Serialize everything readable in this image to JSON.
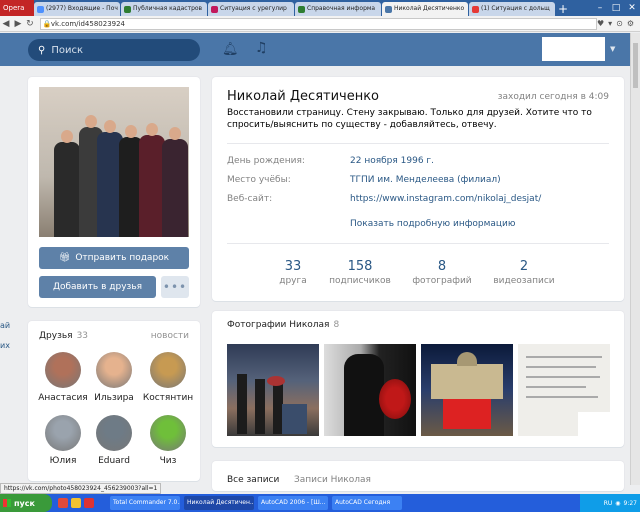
{
  "browser": {
    "menu_label": "Opera",
    "tabs": [
      {
        "title": "(2977) Входящие - Поч",
        "color": "#4d90fe",
        "active": false
      },
      {
        "title": "Публичная кадастров",
        "color": "#2e7d32",
        "active": false
      },
      {
        "title": "Ситуация с урегулир",
        "color": "#c2185b",
        "active": false
      },
      {
        "title": "Справочная информа",
        "color": "#2e7d32",
        "active": false
      },
      {
        "title": "Николай Десятиченко",
        "color": "#4a76a8",
        "active": true
      },
      {
        "title": "(1) Ситуация с дольщ",
        "color": "#e53935",
        "active": false
      }
    ],
    "new_tab": "+",
    "url": "vk.com/id458023924",
    "status_url": "https://vk.com/photo458023924_456239003?all=1"
  },
  "header": {
    "search_placeholder": "Поиск"
  },
  "left_fragments": [
    "ай",
    "их"
  ],
  "profile": {
    "name": "Николай Десятиченко",
    "online": "заходил сегодня в 4:09",
    "status": "Восстановили страницу. Стену закрываю. Только для друзей. Хотите что то спросить/выяснить по существу - добавляйтесь, отвечу.",
    "info": [
      {
        "label": "День рождения:",
        "value": "22 ноября 1996 г."
      },
      {
        "label": "Место учёбы:",
        "value": "ТГПИ им. Менделеева (филиал)"
      },
      {
        "label": "Веб-сайт:",
        "value": "https://www.instagram.com/nikolaj_desjat/"
      }
    ],
    "show_more": "Показать подробную информацию",
    "counters": [
      {
        "num": "33",
        "label": "друга"
      },
      {
        "num": "158",
        "label": "подписчиков"
      },
      {
        "num": "8",
        "label": "фотографий"
      },
      {
        "num": "2",
        "label": "видеозаписи"
      }
    ]
  },
  "actions": {
    "gift": "Отправить подарок",
    "add_friend": "Добавить в друзья",
    "more": "•••"
  },
  "friends": {
    "title": "Друзья",
    "count": "33",
    "news": "новости",
    "list": [
      {
        "name": "Анастасия",
        "color": "#b0715a"
      },
      {
        "name": "Ильзира",
        "color": "#e5b28e"
      },
      {
        "name": "Костянтин",
        "color": "#c79a52"
      },
      {
        "name": "Юлия",
        "color": "#9aa3ad"
      },
      {
        "name": "Eduard",
        "color": "#6e7b86"
      },
      {
        "name": "Чиз",
        "color": "#6fbf3a"
      }
    ]
  },
  "photos": {
    "title": "Фотографии Николая",
    "count": "8"
  },
  "posts": {
    "tab_all": "Все записи",
    "tab_own": "Записи Николая"
  },
  "taskbar": {
    "start": "пуск",
    "items": [
      {
        "title": "Total Commander 7.0...",
        "active": false
      },
      {
        "title": "Николай Десятичен...",
        "active": true
      },
      {
        "title": "AutoCAD 2006 - [Ш...",
        "active": false
      },
      {
        "title": "AutoCAD Сегодня",
        "active": false
      }
    ],
    "lang": "RU",
    "clock": "9:27"
  }
}
